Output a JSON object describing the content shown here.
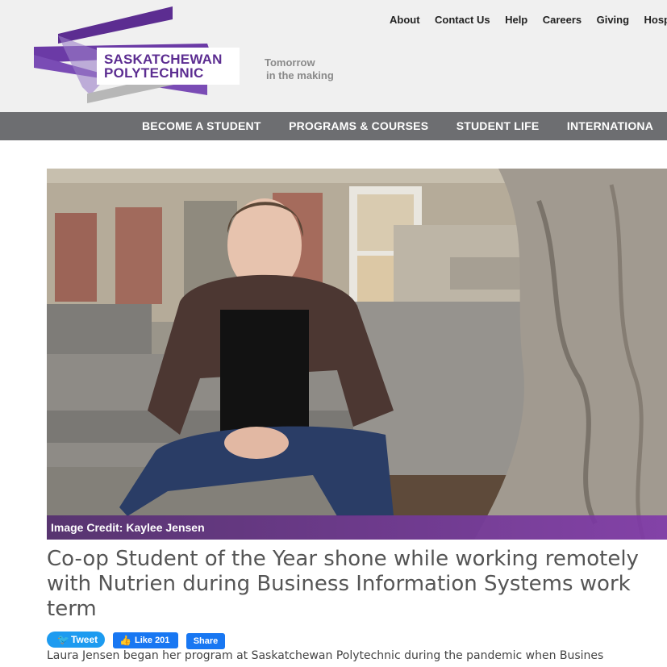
{
  "brand": {
    "name_line1": "SASKATCHEWAN",
    "name_line2": "POLYTECHNIC",
    "tagline_line1": "Tomorrow",
    "tagline_line2": "in the making",
    "colors": {
      "purple": "#5c2d91",
      "light_purple": "#8a4fc0",
      "gray": "#8a8a8a"
    }
  },
  "utility_nav": [
    "About",
    "Contact Us",
    "Help",
    "Careers",
    "Giving",
    "Hospita"
  ],
  "main_nav": [
    "BECOME A STUDENT",
    "PROGRAMS & COURSES",
    "STUDENT LIFE",
    "INTERNATIONA"
  ],
  "hero": {
    "image_credit": "Image Credit: Kaylee Jensen"
  },
  "article": {
    "title": "Co-op Student of the Year shone while working remotely with Nutrien during Business Information Systems work term",
    "intro": "Laura Jensen began her program at Saskatchewan Polytechnic during the pandemic when Busines"
  },
  "share": {
    "tweet_label": "Tweet",
    "like_label": "Like 201",
    "share_label": "Share",
    "colors": {
      "twitter": "#1d9bf0",
      "facebook": "#1877f2"
    }
  }
}
